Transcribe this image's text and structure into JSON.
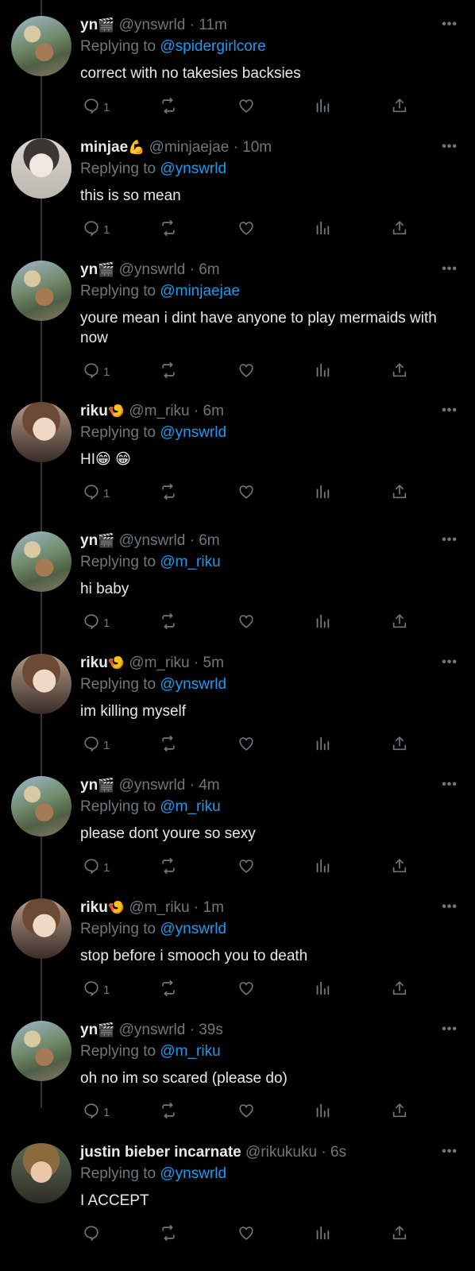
{
  "tweets": [
    {
      "name": "yn",
      "badge": "🎬",
      "handle": "@ynswrld",
      "time": "11m",
      "replying_prefix": "Replying to",
      "replying_to": "@spidergirlcore",
      "text": "correct with no takesies backsies",
      "reply_count": "1",
      "avatar": "yn"
    },
    {
      "name": "minjae",
      "badge": "💪",
      "handle": "@minjaejae",
      "time": "10m",
      "replying_prefix": "Replying to",
      "replying_to": "@ynswrld",
      "text": "this is so mean",
      "reply_count": "1",
      "avatar": "minjae"
    },
    {
      "name": "yn",
      "badge": "🎬",
      "handle": "@ynswrld",
      "time": "6m",
      "replying_prefix": "Replying to",
      "replying_to": "@minjaejae",
      "text": "youre mean i dint have anyone to play mermaids with now",
      "reply_count": "1",
      "avatar": "yn"
    },
    {
      "name": "riku",
      "badge": "🍤",
      "handle": "@m_riku",
      "time": "6m",
      "replying_prefix": "Replying to",
      "replying_to": "@ynswrld",
      "text": "HI😁 😁",
      "reply_count": "1",
      "avatar": "riku"
    },
    {
      "name": "yn",
      "badge": "🎬",
      "handle": "@ynswrld",
      "time": "6m",
      "replying_prefix": "Replying to",
      "replying_to": "@m_riku",
      "text": "hi baby",
      "reply_count": "1",
      "avatar": "yn"
    },
    {
      "name": "riku",
      "badge": "🍤",
      "handle": "@m_riku",
      "time": "5m",
      "replying_prefix": "Replying to",
      "replying_to": "@ynswrld",
      "text": "im killing myself",
      "reply_count": "1",
      "avatar": "riku"
    },
    {
      "name": "yn",
      "badge": "🎬",
      "handle": "@ynswrld",
      "time": "4m",
      "replying_prefix": "Replying to",
      "replying_to": "@m_riku",
      "text": "please dont youre so sexy",
      "reply_count": "1",
      "avatar": "yn"
    },
    {
      "name": "riku",
      "badge": "🍤",
      "handle": "@m_riku",
      "time": "1m",
      "replying_prefix": "Replying to",
      "replying_to": "@ynswrld",
      "text": "stop before i smooch you to death",
      "reply_count": "1",
      "avatar": "riku"
    },
    {
      "name": "yn",
      "badge": "🎬",
      "handle": "@ynswrld",
      "time": "39s",
      "replying_prefix": "Replying to",
      "replying_to": "@m_riku",
      "text": "oh no im so scared (please do)",
      "reply_count": "1",
      "avatar": "yn"
    },
    {
      "name": "justin bieber incarnate",
      "badge": "",
      "handle": "@rikukuku",
      "time": "6s",
      "replying_prefix": "Replying to",
      "replying_to": "@ynswrld",
      "text": "I ACCEPT",
      "reply_count": "",
      "avatar": "justin"
    }
  ],
  "ui": {
    "separator": "·",
    "more_icon": "more-icon",
    "colors": {
      "background": "#000000",
      "text": "#e7e9ea",
      "secondary": "#71767b",
      "accent": "#1d9bf0"
    }
  }
}
